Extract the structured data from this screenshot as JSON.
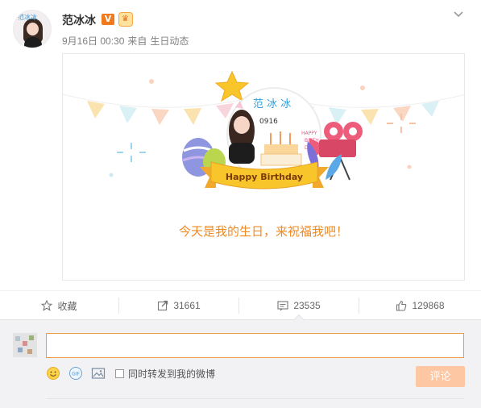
{
  "post": {
    "username": "范冰冰",
    "verified_badge": "V",
    "member_badge": "crown-icon",
    "date": "9月16日 00:30",
    "source_prefix": "来自",
    "source_name": "生日动态",
    "avatar_text": "范冰冰"
  },
  "card": {
    "caption": "今天是我的生日，来祝福我吧！",
    "name_text": "范 冰 冰",
    "date_text": "0916",
    "banner_text": "Happy Birthday",
    "side_text": [
      "HAPPY",
      "BIRTH",
      "DAY!!"
    ]
  },
  "actions": [
    {
      "icon": "star-icon",
      "label": "收藏"
    },
    {
      "icon": "share-icon",
      "label": "31661"
    },
    {
      "icon": "comment-icon",
      "label": "23535"
    },
    {
      "icon": "like-icon",
      "label": "129868"
    }
  ],
  "comment": {
    "input_value": "",
    "repost_label": "同时转发到我的微博",
    "submit_label": "评论",
    "tools": [
      "emoji-icon",
      "gif-icon",
      "image-icon"
    ]
  },
  "colors": {
    "accent": "#f08a22",
    "input_border": "#f29b4b",
    "submit_bg": "#fdc7a4",
    "badge_orange": "#f27a1b"
  }
}
